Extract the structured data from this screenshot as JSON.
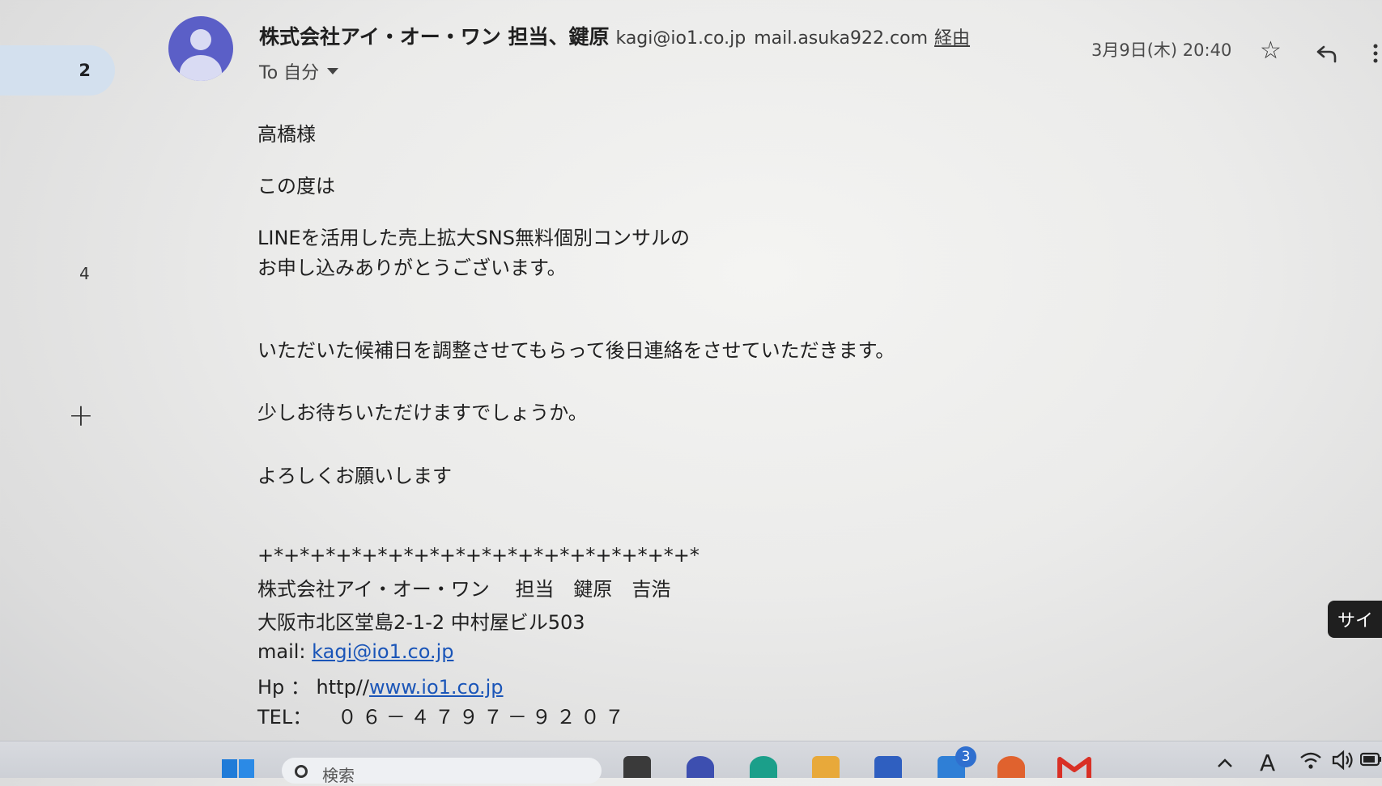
{
  "rail": {
    "badge": "2",
    "count": "4",
    "add_label": "+"
  },
  "email": {
    "sender_name": "株式会社アイ・オー・ワン 担当、鍵原",
    "sender_email": "kagi@io1.co.jp",
    "via_domain": "mail.asuka922.com",
    "via_label": "経由",
    "recipient": "To 自分",
    "date": "3月9日(木) 20:40"
  },
  "body": {
    "greeting": "高橋様",
    "intro": "この度は",
    "line1": "LINEを活用した売上拡大SNS無料個別コンサルの",
    "line2": "お申し込みありがとうございます。",
    "line3": "いただいた候補日を調整させてもらって後日連絡をさせていただきます。",
    "line4": "少しお待ちいただけますでしょうか。",
    "line5": "よろしくお願いします"
  },
  "signature": {
    "divider": "+*+*+*+*+*+*+*+*+*+*+*+*+*+*+*+*+*",
    "company": "株式会社アイ・オー・ワン　 担当　鍵原　吉浩",
    "address": "大阪市北区堂島2-1-2 中村屋ビル503",
    "mail_label": "mail:",
    "mail_link": "kagi@io1.co.jp",
    "hp_label": "Hp ： http//",
    "hp_link": "www.io1.co.jp",
    "tel_label": "TEL：",
    "tel_value": "０６－４７９７－９２０７"
  },
  "side_tab": "サイ",
  "taskbar": {
    "search_label": "検索",
    "mail_badge": "3",
    "ime_label": "A"
  },
  "colors": {
    "avatar": "#5b5fc7",
    "link": "#1a55b8",
    "rail_highlight": "#d3e0ee",
    "gmail_red": "#d93025"
  }
}
